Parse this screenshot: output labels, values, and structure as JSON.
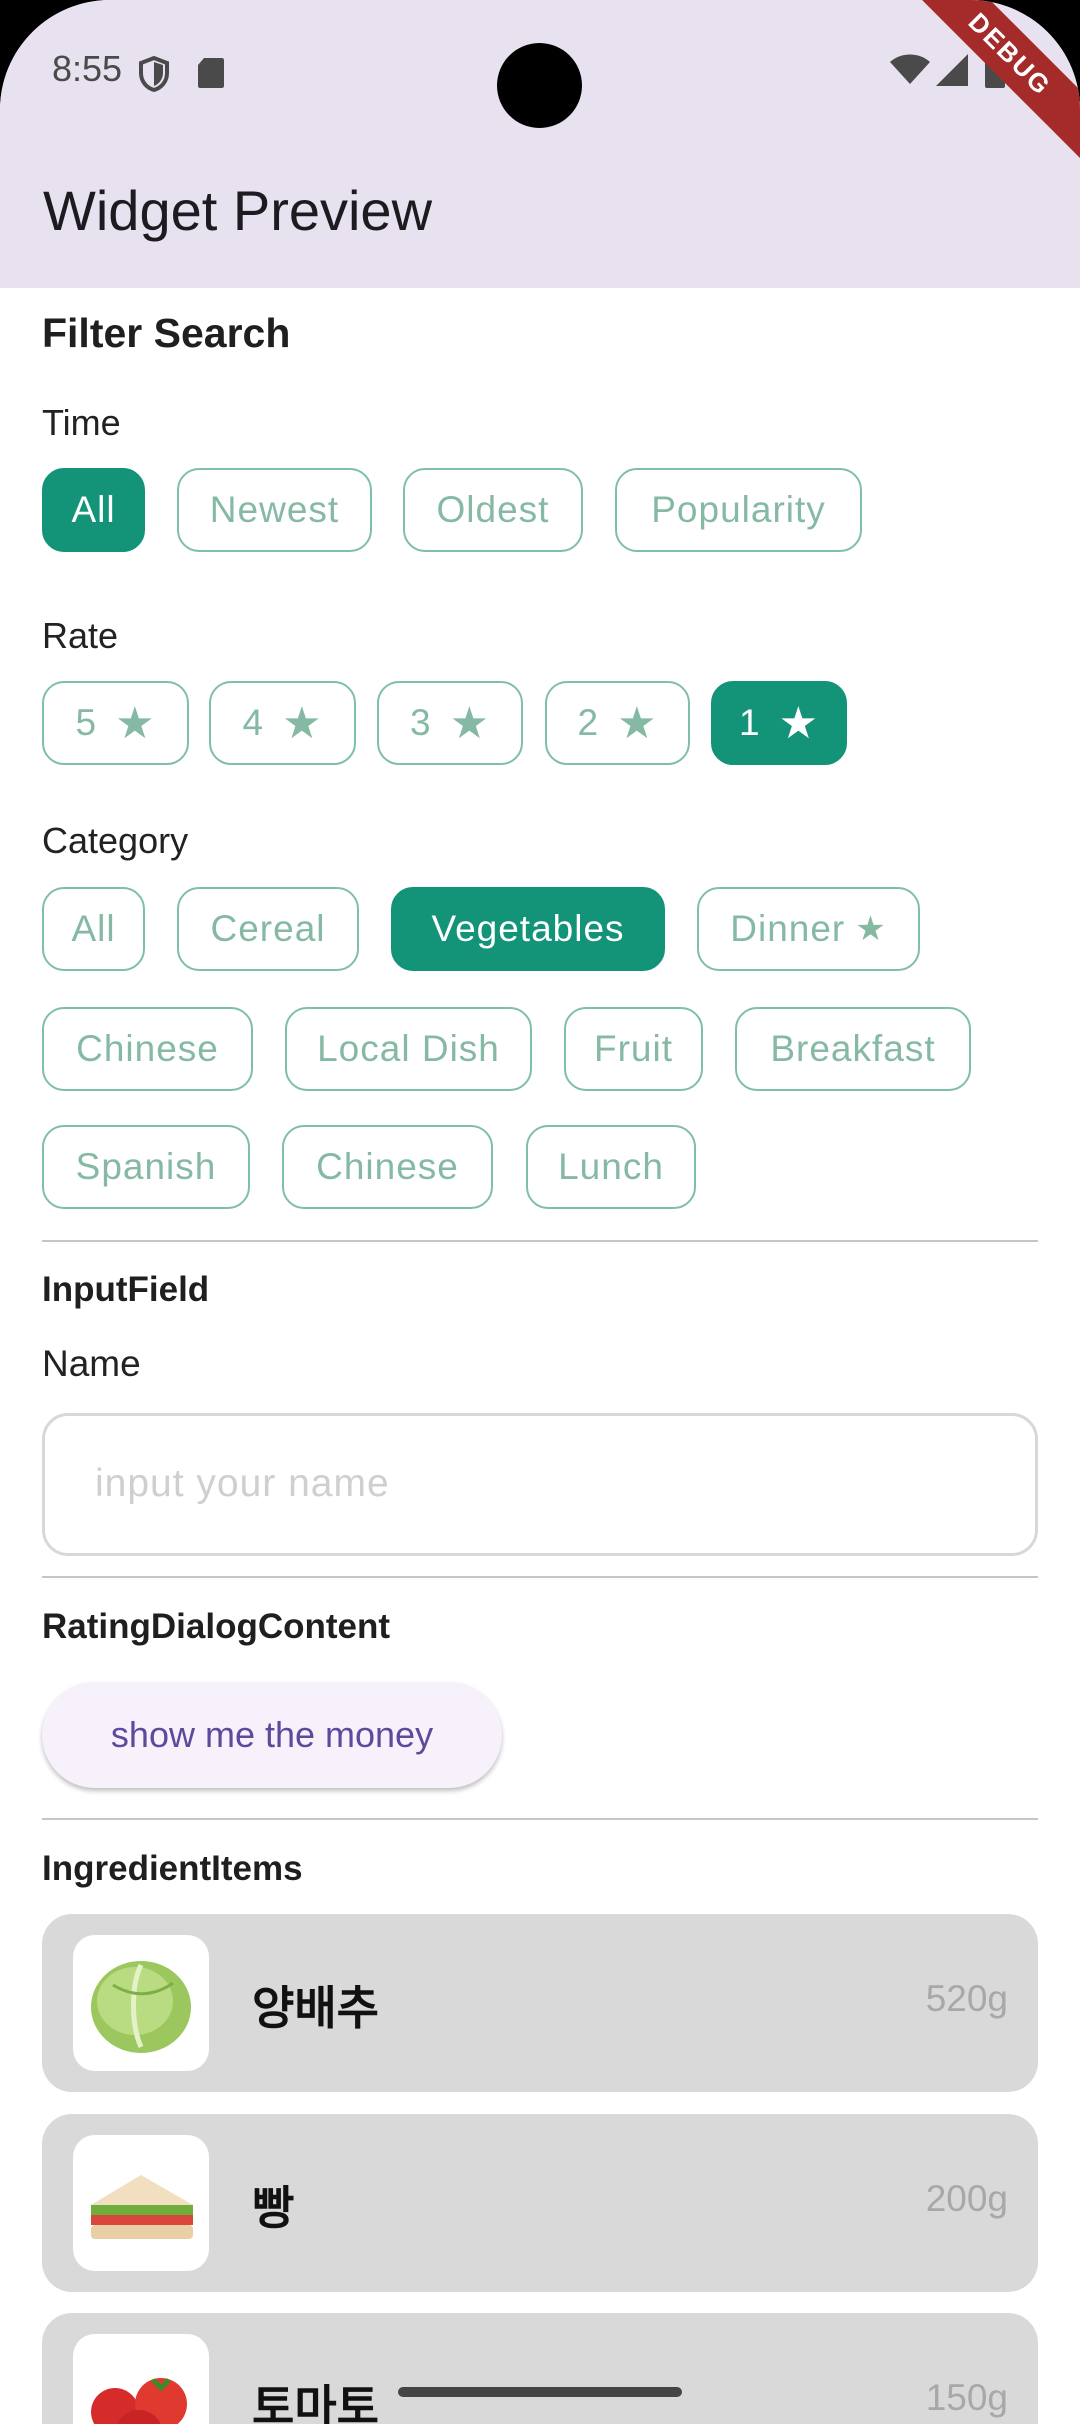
{
  "status_bar": {
    "time": "8:55"
  },
  "debug_banner": "DEBUG",
  "app_bar": {
    "title": "Widget Preview"
  },
  "filter_search": {
    "title": "Filter Search",
    "time_label": "Time",
    "time_options": [
      "All",
      "Newest",
      "Oldest",
      "Popularity"
    ],
    "time_selected": "All",
    "rate_label": "Rate",
    "rate_options": [
      "5",
      "4",
      "3",
      "2",
      "1"
    ],
    "rate_selected": "1",
    "star_glyph": "★",
    "category_label": "Category",
    "category_options": [
      "All",
      "Cereal",
      "Vegetables",
      "Dinner",
      "Chinese",
      "Local Dish",
      "Fruit",
      "Breakfast",
      "Spanish",
      "Chinese",
      "Lunch"
    ],
    "category_selected": "Vegetables"
  },
  "input_field": {
    "title": "InputField",
    "label": "Name",
    "placeholder": "input your name"
  },
  "rating_dialog": {
    "title": "RatingDialogContent",
    "button_label": "show me the money"
  },
  "ingredients": {
    "title": "IngredientItems",
    "items": [
      {
        "name": "양배추",
        "weight": "520g",
        "icon": "cabbage-icon"
      },
      {
        "name": "빵",
        "weight": "200g",
        "icon": "sandwich-icon"
      },
      {
        "name": "토마토",
        "weight": "150g",
        "icon": "tomato-icon"
      }
    ]
  },
  "colors": {
    "accent": "#139378",
    "chip_border": "#7fbfa4",
    "app_bar_bg": "#e8e1ef",
    "button_text": "#5c4a9a"
  }
}
